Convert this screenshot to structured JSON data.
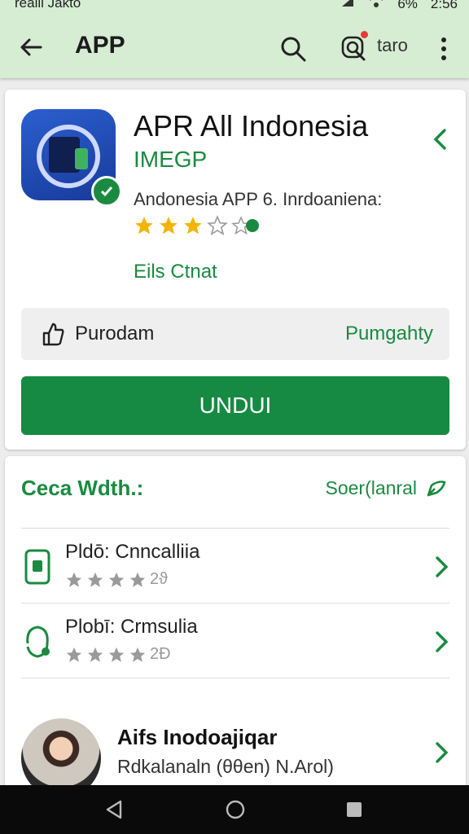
{
  "status_bar": {
    "left_text": "reaill Jakto",
    "battery": "6%",
    "time": "2:56"
  },
  "top_bar": {
    "title": "APP",
    "user_label": "taro",
    "icons": [
      "back-arrow-icon",
      "search-icon",
      "notification-icon",
      "more-vert-icon"
    ]
  },
  "app": {
    "title": "APR All Indonesia",
    "developer": "IMEGP",
    "description": "Andonesia  APP 6. Inrdoaniena:",
    "rating": 3,
    "category": "Eils Ctnat",
    "info_left": "Purodam",
    "info_right": "Pumgahty",
    "install_label": "UNDUI"
  },
  "section": {
    "title": "Ceca Wdth.:",
    "see_all": "Soer(lanral"
  },
  "items": [
    {
      "name": "Pldō: Cnncalliia",
      "rating_text": "2ϑ",
      "rating": 4
    },
    {
      "name": "Plobī: Crmsulia",
      "rating_text": "2Ð",
      "rating": 4
    }
  ],
  "profile": {
    "name": "Aifs Inodoajiqar",
    "subtitle": "Rdkalanaln (θθen) N.Arol)"
  },
  "colors": {
    "accent": "#1a8a40",
    "header_bg": "#d6ecd3",
    "install_bg": "#168a42",
    "star": "#f4b400",
    "star_gray": "#9a9a9a"
  }
}
